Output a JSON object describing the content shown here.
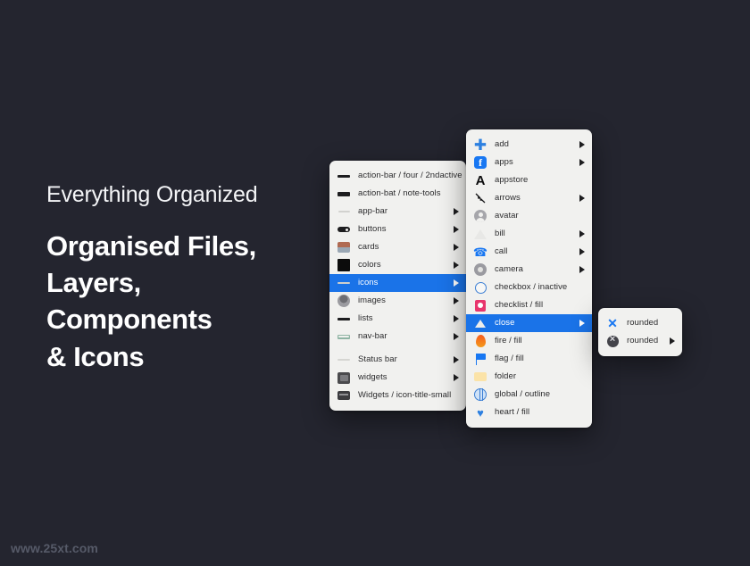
{
  "theme": {
    "background": "#24252f",
    "panel_bg": "#f1f1ef",
    "accent_blue": "#1a73e8",
    "text_dark": "#2c2c2e",
    "text_light": "#ffffff"
  },
  "copy": {
    "eyebrow": "Everything Organized",
    "headline": "Organised Files,\nLayers,\nComponents\n& Icons"
  },
  "watermark": "www.25xt.com",
  "menus": {
    "files_panel": {
      "name": "files-menu",
      "items": [
        {
          "label": "action-bar / four / 2ndactive",
          "icon": "bar-four-thumb",
          "has_submenu": false,
          "selected": false
        },
        {
          "label": "action-bat / note-tools",
          "icon": "bar-thick-thumb",
          "has_submenu": false,
          "selected": false
        },
        {
          "label": "app-bar",
          "icon": "app-bar-thumb",
          "has_submenu": true,
          "selected": false
        },
        {
          "label": "buttons",
          "icon": "toggle-pill-thumb",
          "has_submenu": true,
          "selected": false
        },
        {
          "label": "cards",
          "icon": "card-image-thumb",
          "has_submenu": true,
          "selected": false
        },
        {
          "label": "colors",
          "icon": "color-swatch-thumb",
          "has_submenu": true,
          "selected": false
        },
        {
          "label": "icons",
          "icon": "icons-thumb",
          "has_submenu": true,
          "selected": true
        },
        {
          "label": "images",
          "icon": "avatar-photo-thumb",
          "has_submenu": true,
          "selected": false
        },
        {
          "label": "lists",
          "icon": "list-bar-thumb",
          "has_submenu": true,
          "selected": false
        },
        {
          "label": "nav-bar",
          "icon": "nav-bar-thumb",
          "has_submenu": true,
          "selected": false
        },
        {
          "label": "Status bar",
          "icon": "status-bar-thumb",
          "has_submenu": true,
          "selected": false
        },
        {
          "label": "widgets",
          "icon": "widget-thumb",
          "has_submenu": true,
          "selected": false
        },
        {
          "label": "Widgets / icon-title-small",
          "icon": "widget-small-thumb",
          "has_submenu": false,
          "selected": false
        }
      ]
    },
    "icons_panel": {
      "name": "icons-menu",
      "items": [
        {
          "label": "add",
          "icon": "plus-icon",
          "has_submenu": true,
          "selected": false
        },
        {
          "label": "apps",
          "icon": "facebook-icon",
          "has_submenu": true,
          "selected": false
        },
        {
          "label": "appstore",
          "icon": "appstore-icon",
          "has_submenu": false,
          "selected": false
        },
        {
          "label": "arrows",
          "icon": "arrows-icon",
          "has_submenu": true,
          "selected": false
        },
        {
          "label": "avatar",
          "icon": "avatar-icon",
          "has_submenu": false,
          "selected": false
        },
        {
          "label": "bill",
          "icon": "bill-icon",
          "has_submenu": true,
          "selected": false
        },
        {
          "label": "call",
          "icon": "phone-icon",
          "has_submenu": true,
          "selected": false
        },
        {
          "label": "camera",
          "icon": "camera-icon",
          "has_submenu": true,
          "selected": false
        },
        {
          "label": "checkbox / inactive",
          "icon": "checkbox-icon",
          "has_submenu": false,
          "selected": false
        },
        {
          "label": "checklist / fill",
          "icon": "checklist-icon",
          "has_submenu": false,
          "selected": false
        },
        {
          "label": "close",
          "icon": "close-icon",
          "has_submenu": true,
          "selected": true
        },
        {
          "label": "fire / fill",
          "icon": "fire-icon",
          "has_submenu": false,
          "selected": false
        },
        {
          "label": "flag / fill",
          "icon": "flag-icon",
          "has_submenu": false,
          "selected": false
        },
        {
          "label": "folder",
          "icon": "folder-icon",
          "has_submenu": false,
          "selected": false
        },
        {
          "label": "global / outline",
          "icon": "globe-icon",
          "has_submenu": false,
          "selected": false
        },
        {
          "label": "heart / fill",
          "icon": "heart-icon",
          "has_submenu": false,
          "selected": false
        }
      ]
    },
    "close_panel": {
      "name": "close-submenu",
      "items": [
        {
          "label": "rounded",
          "icon": "close-x-icon",
          "has_submenu": false,
          "selected": false
        },
        {
          "label": "rounded",
          "icon": "close-circle-icon",
          "has_submenu": true,
          "selected": false
        }
      ]
    }
  }
}
